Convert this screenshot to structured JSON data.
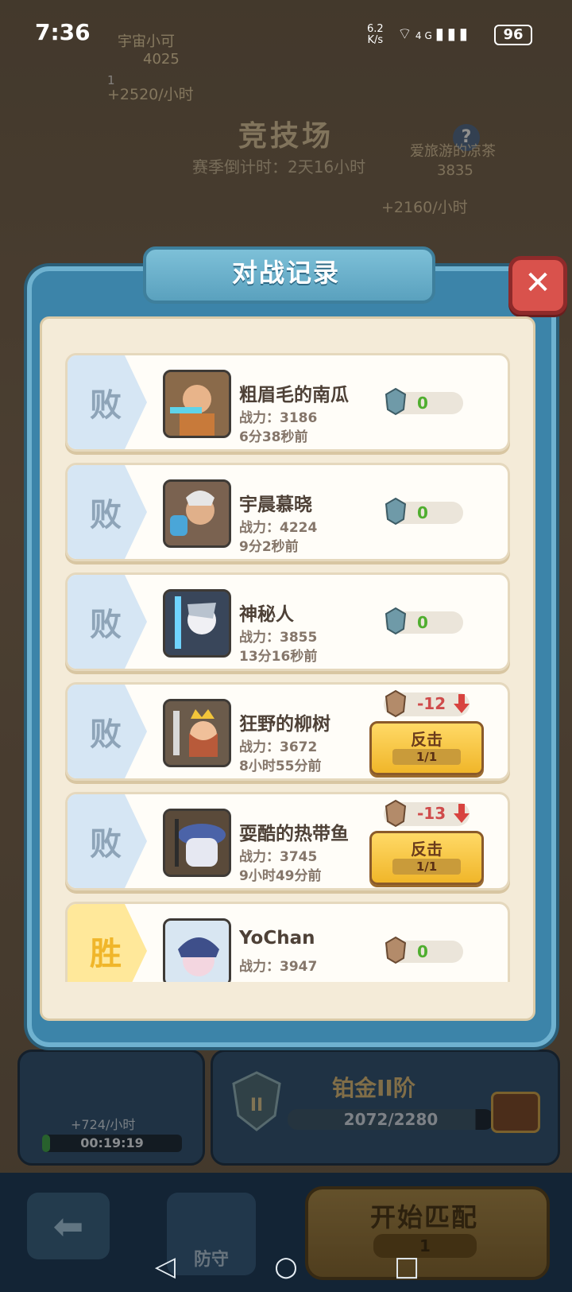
{
  "status_bar": {
    "time": "7:36",
    "net_speed": "6.2\nK/s",
    "network": "4G",
    "battery": "96"
  },
  "background": {
    "player_name": "宇宙小可",
    "player_trophies": "4025",
    "player_rank": "1",
    "player_rate": "+2520/小时",
    "arena_title": "竞技场",
    "season_countdown": "赛季倒计时：2天16小时",
    "rival_name": "爱旅游的凉茶",
    "rival_trophies": "3835",
    "rival_rate": "+2160/小时",
    "help_label": "?"
  },
  "modal": {
    "title": "对战记录",
    "close_label": "✕"
  },
  "records": [
    {
      "result": "败",
      "outcome": "loss",
      "name": "粗眉毛的南瓜",
      "power": "战力：3186",
      "time": "6分38秒前",
      "score": "0",
      "revenge": false
    },
    {
      "result": "败",
      "outcome": "loss",
      "name": "宇晨慕晓",
      "power": "战力：4224",
      "time": "9分2秒前",
      "score": "0",
      "revenge": false
    },
    {
      "result": "败",
      "outcome": "loss",
      "name": "神秘人",
      "power": "战力：3855",
      "time": "13分16秒前",
      "score": "0",
      "revenge": false
    },
    {
      "result": "败",
      "outcome": "loss",
      "name": "狂野的柳树",
      "power": "战力：3672",
      "time": "8小时55分前",
      "score": "-12",
      "revenge": true,
      "revenge_label": "反击",
      "revenge_count": "1/1"
    },
    {
      "result": "败",
      "outcome": "loss",
      "name": "耍酷的热带鱼",
      "power": "战力：3745",
      "time": "9小时49分前",
      "score": "-13",
      "revenge": true,
      "revenge_label": "反击",
      "revenge_count": "1/1"
    },
    {
      "result": "胜",
      "outcome": "win",
      "name": "YoChan",
      "power": "战力：3947",
      "time": "",
      "score": "0",
      "revenge": false
    }
  ],
  "bottom": {
    "idle_rate": "+724/小时",
    "idle_timer": "00:19:19",
    "rank_name": "铂金II阶",
    "rank_progress": "2072/2280",
    "rank_progress_fraction": 0.909,
    "back_icon": "arrow-left-icon",
    "defend_label": "防守",
    "match_label": "开始匹配",
    "match_cost": "1"
  },
  "colors": {
    "loss_tab": "#d6e6f4",
    "win_tab": "#ffe89a",
    "score_positive": "#4fae2f",
    "score_negative": "#cf4b4b",
    "modal_frame": "#3c84a9"
  }
}
